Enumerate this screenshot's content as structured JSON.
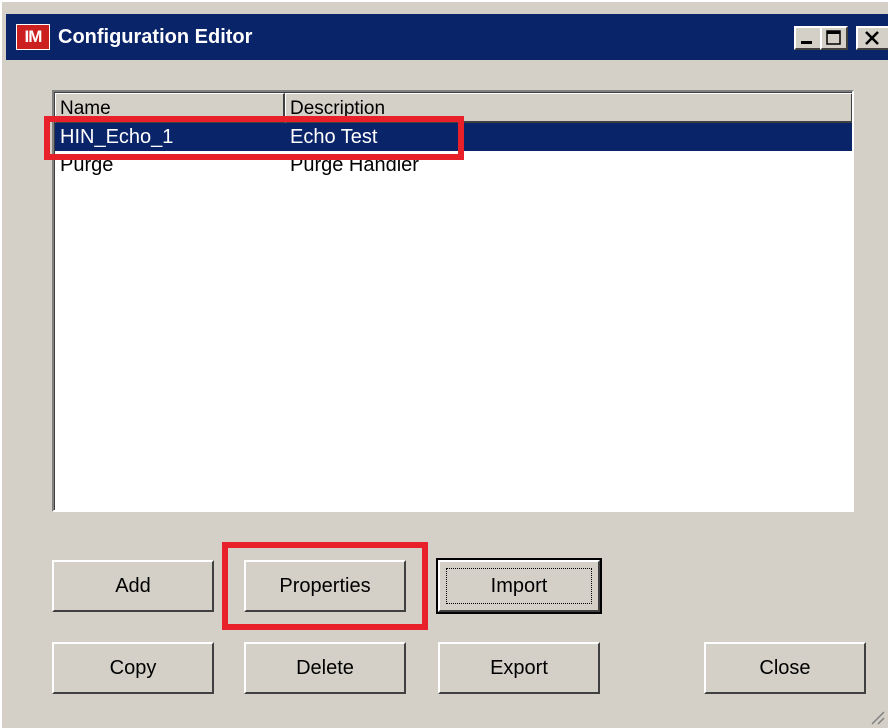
{
  "window": {
    "app_icon_text": "IM",
    "title": "Configuration Editor"
  },
  "list": {
    "columns": [
      "Name",
      "Description"
    ],
    "rows": [
      {
        "name": "HIN_Echo_1",
        "description": "Echo Test",
        "selected": true
      },
      {
        "name": "Purge",
        "description": "Purge Handler",
        "selected": false
      }
    ]
  },
  "buttons": {
    "add": "Add",
    "properties": "Properties",
    "import": "Import",
    "copy": "Copy",
    "delete": "Delete",
    "export": "Export",
    "close": "Close"
  },
  "colors": {
    "titlebar": "#0a246a",
    "selection": "#0a246a",
    "highlight": "#e8202a",
    "face": "#d4d0c8"
  }
}
